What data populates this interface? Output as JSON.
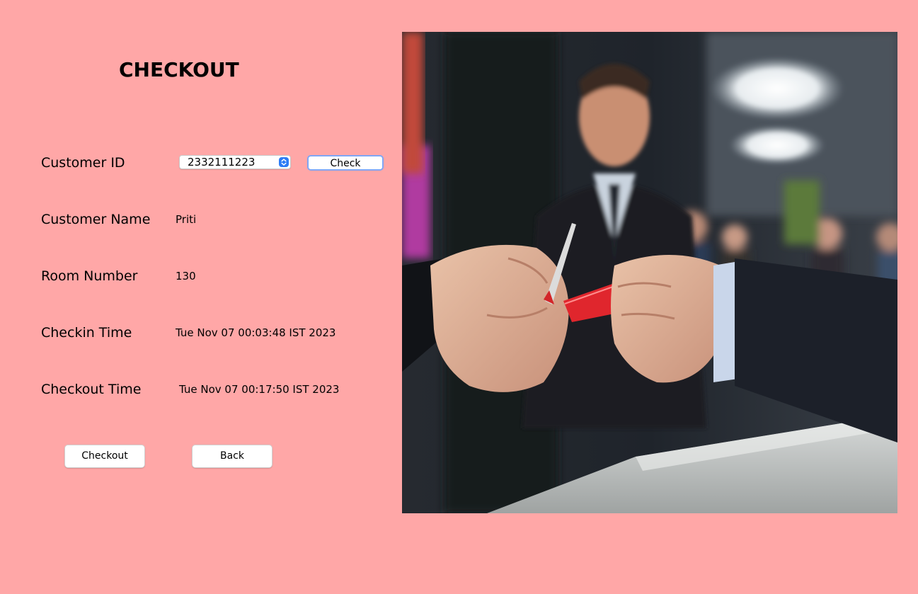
{
  "page": {
    "title": "CHECKOUT",
    "background": "#FFA7A7"
  },
  "form": {
    "customer_id": {
      "label": "Customer ID",
      "selected": "2332111223"
    },
    "check_button": "Check",
    "customer_name": {
      "label": "Customer Name",
      "value": "Priti"
    },
    "room_number": {
      "label": "Room Number",
      "value": "130"
    },
    "checkin_time": {
      "label": "Checkin Time",
      "value": "Tue Nov 07 00:03:48 IST 2023"
    },
    "checkout_time": {
      "label": "Checkout Time",
      "value": "Tue Nov 07 00:17:50 IST 2023"
    }
  },
  "actions": {
    "checkout_button": "Checkout",
    "back_button": "Back"
  },
  "image": {
    "icon": "hotel-reception-card-payment-photo"
  },
  "colors": {
    "accent": "#2c7cf6",
    "focus_ring": "#7fa6f5"
  }
}
